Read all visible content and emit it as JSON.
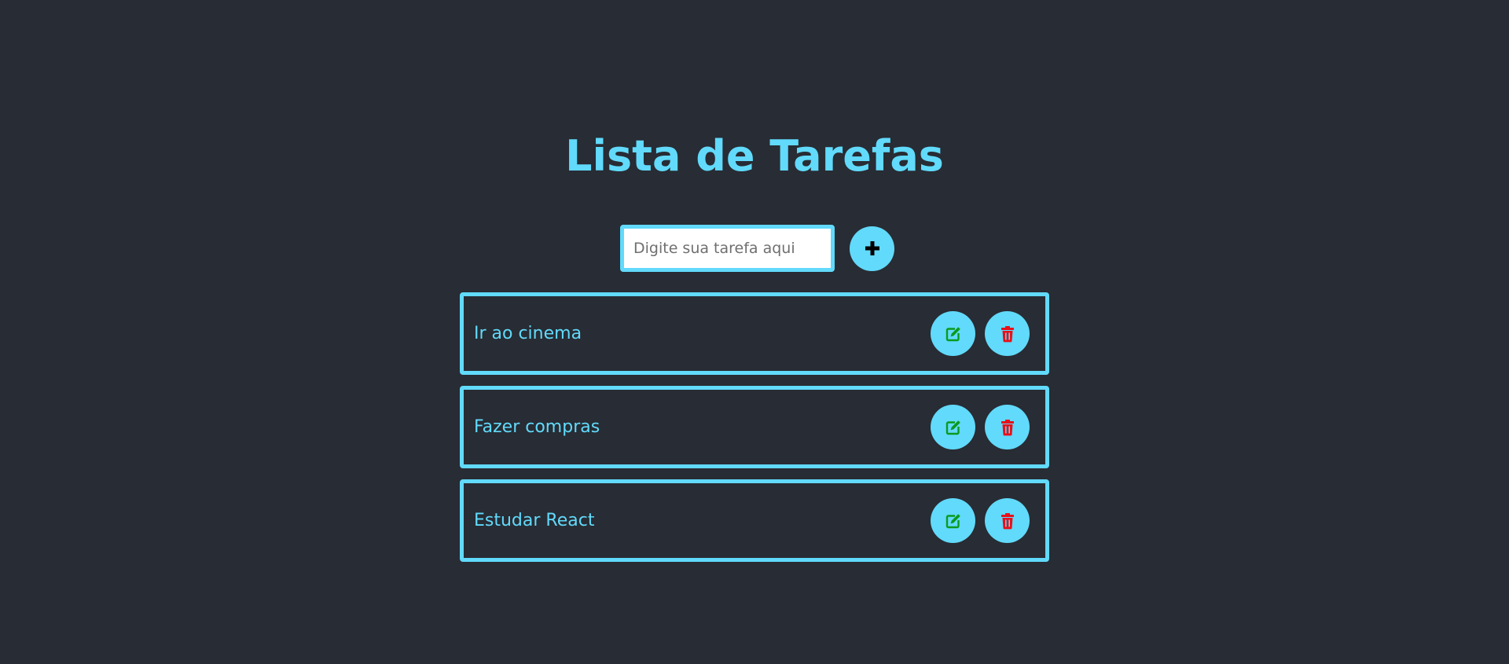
{
  "header": {
    "title": "Lista de Tarefas"
  },
  "new_task": {
    "value": "",
    "placeholder": "Digite sua tarefa aqui",
    "add_icon": "plus-icon"
  },
  "tasks": [
    {
      "text": "Ir ao cinema",
      "edit_icon": "edit-icon",
      "delete_icon": "trash-icon"
    },
    {
      "text": "Fazer compras",
      "edit_icon": "edit-icon",
      "delete_icon": "trash-icon"
    },
    {
      "text": "Estudar React",
      "edit_icon": "edit-icon",
      "delete_icon": "trash-icon"
    }
  ],
  "colors": {
    "background": "#282c34",
    "accent": "#61dafb",
    "edit": "#0a9a1e",
    "delete": "#e8101a"
  }
}
